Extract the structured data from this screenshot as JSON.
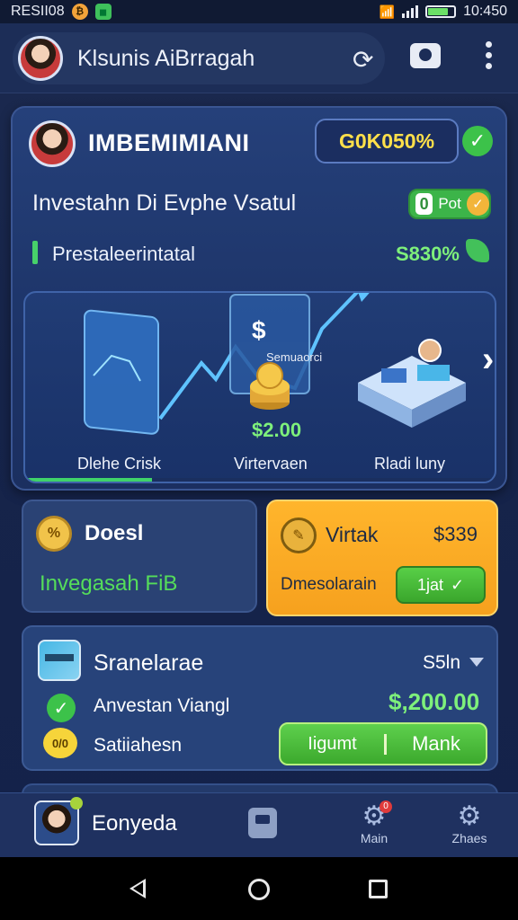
{
  "status_bar": {
    "carrier": "RESII08",
    "time": "10:450",
    "battery_level": 0.8
  },
  "header": {
    "title": "Klsunis AiBrragah",
    "refresh_icon": "refresh-icon",
    "camera_icon": "camera-icon",
    "menu_icon": "more-vert-icon"
  },
  "main_card": {
    "user_name": "IMBEMIMIANI",
    "balance": "G0K050%",
    "headline": "Investahn Di Evphe Vsatul",
    "plot_toggle": {
      "number": "0",
      "label": "Pot"
    },
    "subline": "Prestaleerintatal",
    "growth": "S830%",
    "showcase": {
      "items": [
        {
          "caption": "Dlehe Crisk"
        },
        {
          "caption": "Virtervaen",
          "price": "$2.00",
          "tag": "Semuaorci",
          "symbol": "$"
        },
        {
          "caption": "Rladi luny"
        }
      ],
      "progress": 0.27
    }
  },
  "card_blue": {
    "title": "Doesl",
    "subtitle": "Invegasah FiB"
  },
  "card_orange": {
    "title": "Virtak",
    "amount": "$339",
    "subtitle": "Dmesolarain",
    "button": "1jat"
  },
  "wallet": {
    "title": "Sranelarae",
    "meta": "S5ln",
    "row1": "Anvestan Viangl",
    "total": "$,200.00",
    "coin_label": "0/0",
    "row2": "Satiiahesn",
    "button_left": "Iigumt",
    "button_right": "Mank"
  },
  "bottom_nav": {
    "profile_name": "Eonyeda",
    "item1": {
      "label": "Main",
      "badge": "0"
    },
    "item2": {
      "label": "Zhaes"
    }
  },
  "colors": {
    "accent_green": "#3cc24a",
    "accent_orange": "#f6a11e",
    "balance_yellow": "#ffe04a"
  }
}
